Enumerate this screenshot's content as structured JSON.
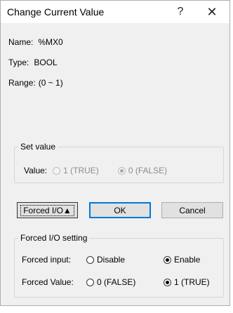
{
  "window": {
    "title": "Change Current Value",
    "help_glyph": "?",
    "close_glyph": "✕"
  },
  "info": {
    "name_label": "Name:",
    "name_value": "%MX0",
    "type_label": "Type:",
    "type_value": "BOOL",
    "range_label": "Range:",
    "range_value": "(0 ~ 1)"
  },
  "set_value": {
    "group_label": "Set value",
    "value_label": "Value:",
    "option_true": "1 (TRUE)",
    "option_false": "0 (FALSE)",
    "selected": "0 (FALSE)",
    "enabled": false
  },
  "buttons": {
    "forced_io": "Forced I/O▲",
    "ok": "OK",
    "cancel": "Cancel"
  },
  "forced_io": {
    "group_label": "Forced I/O setting",
    "input_label": "Forced input:",
    "input_disable": "Disable",
    "input_enable": "Enable",
    "input_selected": "Enable",
    "value_label": "Forced Value:",
    "value_false": "0 (FALSE)",
    "value_true": "1 (TRUE)",
    "value_selected": "1 (TRUE)"
  }
}
